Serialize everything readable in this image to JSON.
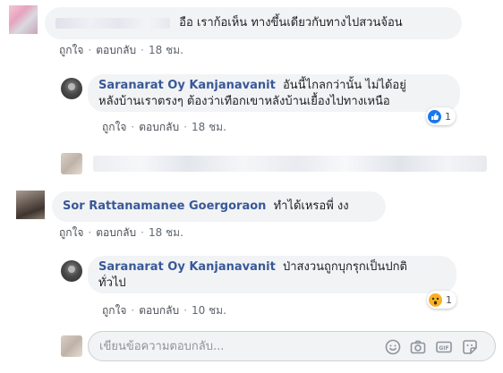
{
  "comments": [
    {
      "author": "",
      "text": "อือ เราก้อเห็น ทางขึ้นเดียวกับทางไปสวนจ้อน",
      "actions": {
        "like": "ถูกใจ",
        "reply": "ตอบกลับ",
        "time": "18 ชม."
      }
    },
    {
      "author": "Saranarat Oy Kanjanavanit",
      "text_line1": "อันนี้ไกลกว่านั้น ไม่ได้อยู่",
      "text_line2": "หลังบ้านเราตรงๆ ต้องว่าเทือกเขาหลังบ้านเยื้องไปทางเหนือ",
      "reaction": {
        "icon": "like-reaction-icon",
        "count": "1"
      },
      "actions": {
        "like": "ถูกใจ",
        "reply": "ตอบกลับ",
        "time": "18 ชม."
      }
    },
    {
      "author": "Sor Rattanamanee Goergoraon",
      "text": "ทำได้เหรอพี่ งง",
      "actions": {
        "like": "ถูกใจ",
        "reply": "ตอบกลับ",
        "time": "18 ชม."
      }
    },
    {
      "author": "Saranarat Oy Kanjanavanit",
      "text_line1": "ป่าสงวนถูกบุกรุกเป็นปกติ",
      "text_line2": "ทั่วไป",
      "reaction": {
        "icon": "wow-reaction-icon",
        "count": "1"
      },
      "actions": {
        "like": "ถูกใจ",
        "reply": "ตอบกลับ",
        "time": "10 ชม."
      }
    }
  ],
  "composer": {
    "placeholder": "เขียนข้อความตอบกลับ...",
    "icons": [
      "emoji-icon",
      "camera-icon",
      "gif-icon",
      "sticker-icon"
    ]
  },
  "colors": {
    "author_link": "#385898",
    "bubble_bg": "#f2f3f5",
    "meta_text": "#606770",
    "like_blue": "#1877f2",
    "wow_yellow": "#f7b125"
  }
}
